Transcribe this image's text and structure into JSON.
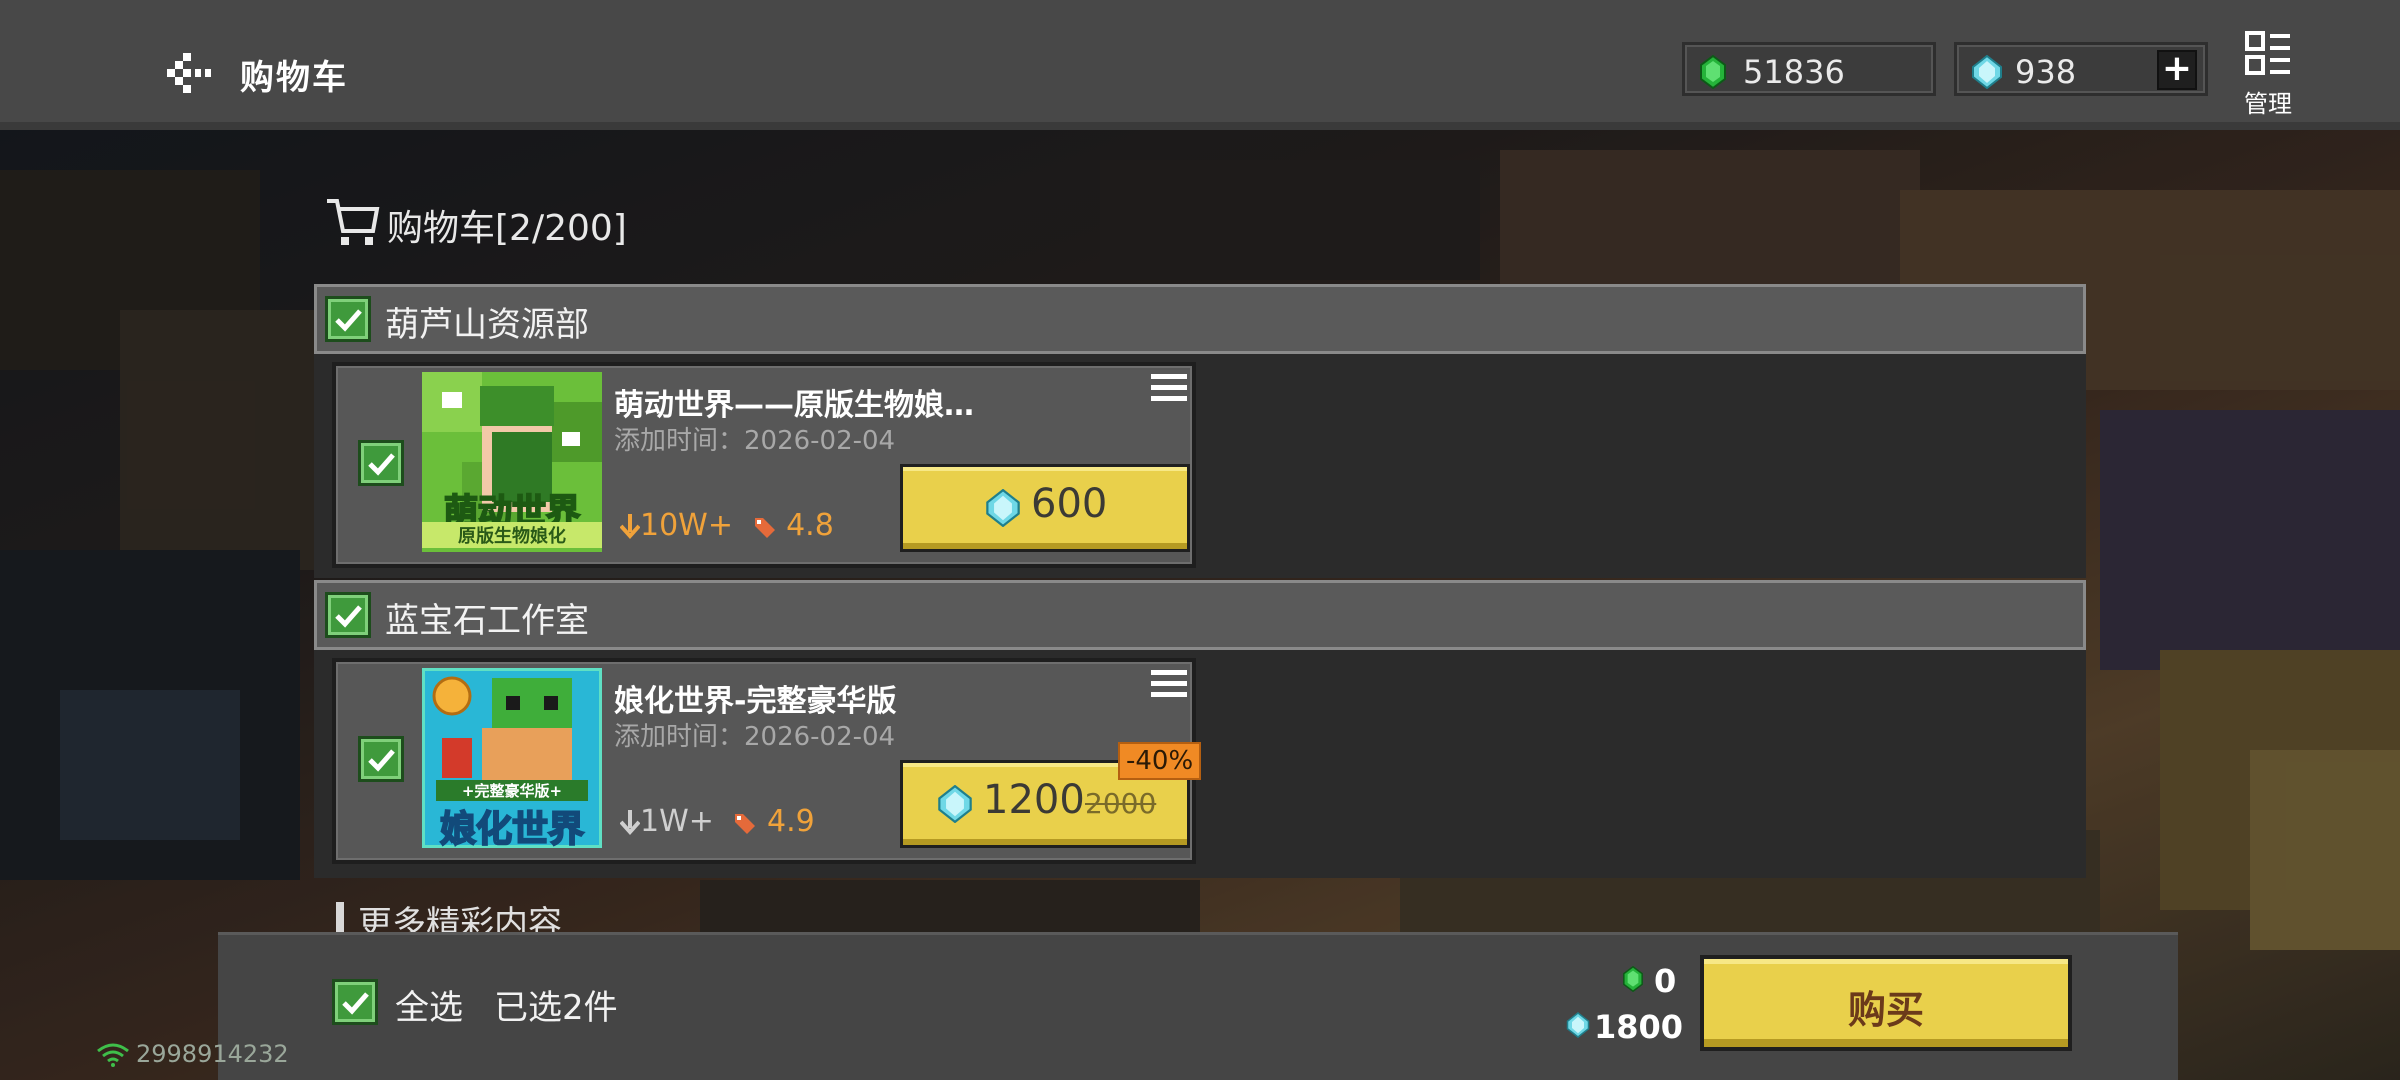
{
  "header": {
    "title": "购物车",
    "emerald_balance": "51836",
    "diamond_balance": "938",
    "add_label": "+",
    "manage_label": "管理"
  },
  "cart": {
    "heading": "购物车[2/200]"
  },
  "groups": [
    {
      "name": "葫芦山资源部",
      "item": {
        "title": "萌动世界——原版生物娘…",
        "date": "添加时间：2026-02-04",
        "downloads": "10W+",
        "rating": "4.8",
        "price": "600",
        "thumb_lines": [
          "萌动世界",
          "原版生物娘化"
        ]
      }
    },
    {
      "name": "蓝宝石工作室",
      "item": {
        "title": "娘化世界-完整豪华版",
        "date": "添加时间：2026-02-04",
        "downloads": "1W+",
        "rating": "4.9",
        "price": "1200",
        "old_price": "2000",
        "discount": "-40%",
        "thumb_lines": [
          "+完整豪华版+",
          "娘化世界"
        ]
      }
    }
  ],
  "more_label": "更多精彩内容",
  "footer": {
    "select_all_label": "全选",
    "selected_count": "已选2件",
    "total_emerald": "0",
    "total_diamond": "1800",
    "buy_label": "购买"
  },
  "status": {
    "id": "2998914232"
  },
  "colors": {
    "accent_yellow": "#e9d04b",
    "check_green": "#3f9a3c",
    "stat_orange": "#f0a23a",
    "discount_orange": "#f08a24"
  },
  "icons": [
    "back-icon",
    "emerald-icon",
    "diamond-icon",
    "plus-icon",
    "manage-icon",
    "cart-icon",
    "check-icon",
    "menu-icon",
    "download-icon",
    "rating-icon",
    "wifi-icon"
  ]
}
